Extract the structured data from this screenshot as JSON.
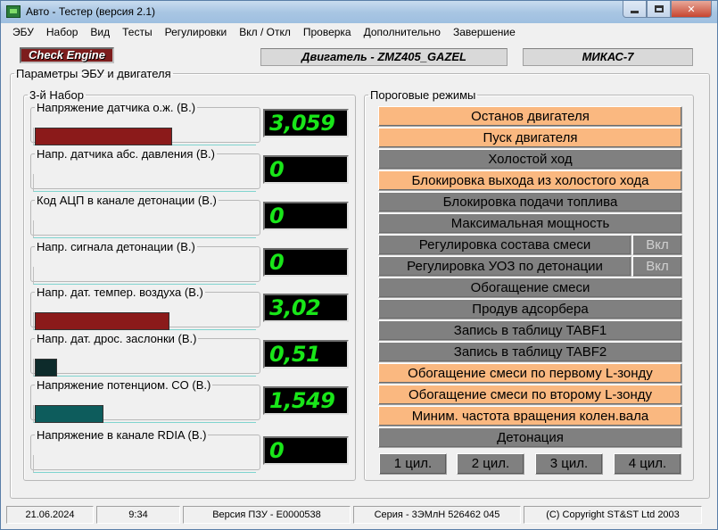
{
  "window": {
    "title": "Авто - Тестер  (версия 2.1)"
  },
  "menu": [
    "ЭБУ",
    "Набор",
    "Вид",
    "Тесты",
    "Регулировки",
    "Вкл / Откл",
    "Проверка",
    "Дополнительно",
    "Завершение"
  ],
  "top": {
    "check_engine": "Check Engine",
    "engine": "Двигатель - ZMZ405_GAZEL",
    "ecu": "МИКАС-7"
  },
  "params_group": {
    "title": "Параметры ЭБУ и двигателя",
    "set_title": "3-й  Набор"
  },
  "sensors": [
    {
      "label": "Напряжение датчика о.ж. (В.)",
      "value": "3,059",
      "level": 0.62,
      "color": "#8b1a1a"
    },
    {
      "label": "Напр. датчика абс. давления (В.)",
      "value": "0",
      "level": 0,
      "color": "#8b1a1a"
    },
    {
      "label": "Код АЦП в канале детонации (В.)",
      "value": "0",
      "level": 0,
      "color": "#8b1a1a"
    },
    {
      "label": "Напр.  сигнала   детонации (В.)",
      "value": "0",
      "level": 0,
      "color": "#8b1a1a"
    },
    {
      "label": "Напр. дат. темпер. воздуха (В.)",
      "value": "3,02",
      "level": 0.61,
      "color": "#8b1a1a"
    },
    {
      "label": "Напр.  дат.  дрос. заслонки (В.)",
      "value": "0,51",
      "level": 0.1,
      "color": "#0d2b2b"
    },
    {
      "label": "Напряжение потенциом. CO (В.)",
      "value": "1,549",
      "level": 0.31,
      "color": "#0d5c5c"
    },
    {
      "label": "Напряжение в канале RDIA (В.)",
      "value": "0",
      "level": 0,
      "color": "#8b1a1a"
    }
  ],
  "modes_group": {
    "title": "Пороговые режимы"
  },
  "modes": [
    {
      "label": "Останов двигателя",
      "state": "on"
    },
    {
      "label": "Пуск двигателя",
      "state": "on"
    },
    {
      "label": "Холостой ход",
      "state": "off"
    },
    {
      "label": "Блокировка выхода из холостого хода",
      "state": "on"
    },
    {
      "label": "Блокировка подачи топлива",
      "state": "off"
    },
    {
      "label": "Максимальная мощность",
      "state": "off"
    },
    {
      "label": "Регулировка состава смеси",
      "state": "off",
      "toggle": "Вкл"
    },
    {
      "label": "Регулировка УОЗ по детонации",
      "state": "off",
      "toggle": "Вкл"
    },
    {
      "label": "Обогащение смеси",
      "state": "off"
    },
    {
      "label": "Продув адсорбера",
      "state": "off"
    },
    {
      "label": "Запись в таблицу TABF1",
      "state": "off"
    },
    {
      "label": "Запись в таблицу TABF2",
      "state": "off"
    },
    {
      "label": "Обогащение смеси по первому L-зонду",
      "state": "on"
    },
    {
      "label": "Обогащение смеси по второму L-зонду",
      "state": "on"
    },
    {
      "label": "Миним. частота вращения колен.вала",
      "state": "on"
    },
    {
      "label": "Детонация",
      "state": "off"
    }
  ],
  "cylinders": [
    "1 цил.",
    "2 цил.",
    "3 цил.",
    "4 цил."
  ],
  "status": {
    "date": "21.06.2024",
    "time": "9:34",
    "rom": "Версия ПЗУ - E0000538",
    "serial": "Серия - 3ЭМлН 526462 045",
    "copyright": "(C) Copyright   ST&ST  Ltd 2003"
  },
  "colors": {
    "mode_on": "#fab880",
    "mode_off": "#808080",
    "display_text": "#19e619"
  }
}
